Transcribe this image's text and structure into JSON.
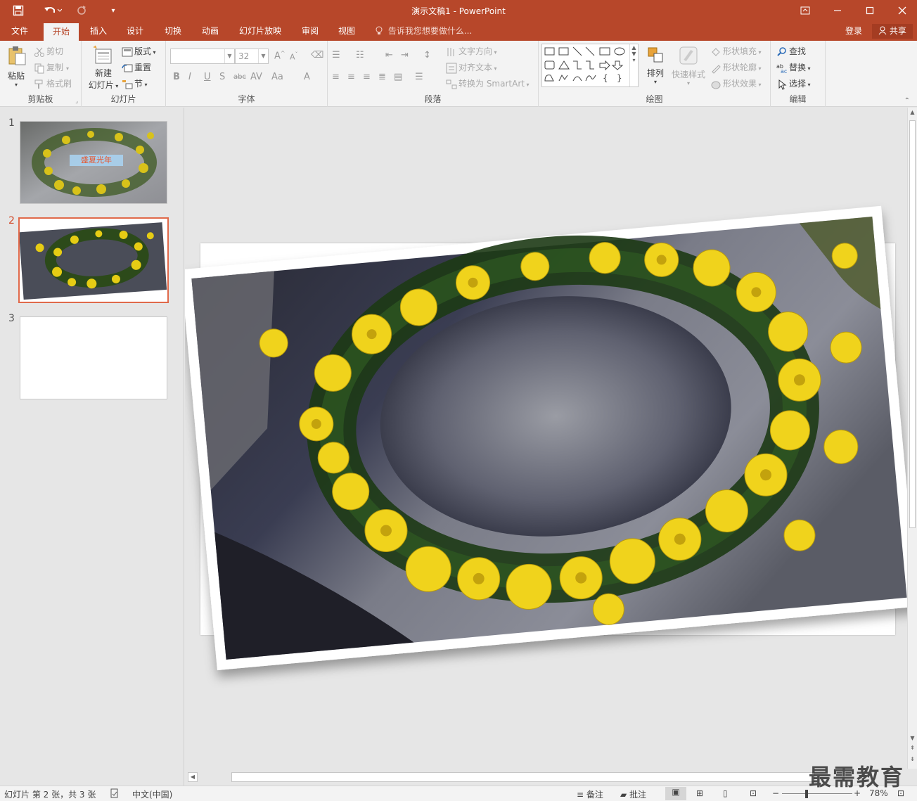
{
  "window": {
    "title": "演示文稿1 - PowerPoint",
    "controls": [
      "ribbon-display-icon",
      "minimize-icon",
      "maximize-icon",
      "close-icon"
    ]
  },
  "tabs": [
    {
      "label": "文件"
    },
    {
      "label": "开始"
    },
    {
      "label": "插入"
    },
    {
      "label": "设计"
    },
    {
      "label": "切换"
    },
    {
      "label": "动画"
    },
    {
      "label": "幻灯片放映"
    },
    {
      "label": "审阅"
    },
    {
      "label": "视图"
    }
  ],
  "active_tab": "开始",
  "tell_me": "告诉我您想要做什么...",
  "account": {
    "login": "登录",
    "share": "共享"
  },
  "ribbon": {
    "clipboard": {
      "label": "剪贴板",
      "paste": "粘贴",
      "cut": "剪切",
      "copy": "复制",
      "format_painter": "格式刷"
    },
    "slides": {
      "label": "幻灯片",
      "new_slide_1": "新建",
      "new_slide_2": "幻灯片",
      "layout": "版式",
      "reset": "重置",
      "section": "节"
    },
    "font": {
      "label": "字体",
      "font_name": "",
      "font_size": "32"
    },
    "paragraph": {
      "label": "段落",
      "text_direction": "文字方向",
      "align_text": "对齐文本",
      "convert_smartart": "转换为 SmartArt"
    },
    "drawing": {
      "label": "绘图",
      "arrange": "排列",
      "quick_styles": "快速样式",
      "shape_fill": "形状填充",
      "shape_outline": "形状轮廓",
      "shape_effects": "形状效果"
    },
    "editing": {
      "label": "编辑",
      "find": "查找",
      "replace": "替换",
      "select": "选择"
    }
  },
  "slides": [
    {
      "number": "1",
      "title_text": "盛夏光年"
    },
    {
      "number": "2"
    },
    {
      "number": "3"
    }
  ],
  "selected_slide": 2,
  "status": {
    "slide_info": "幻灯片 第 2 张，共 3 张",
    "language": "中文(中国)",
    "notes": "备注",
    "comments": "批注",
    "zoom": "78%"
  },
  "watermark": "最需教育",
  "colors": {
    "accent": "#b7472a",
    "selected_thumb": "#e0694a"
  }
}
